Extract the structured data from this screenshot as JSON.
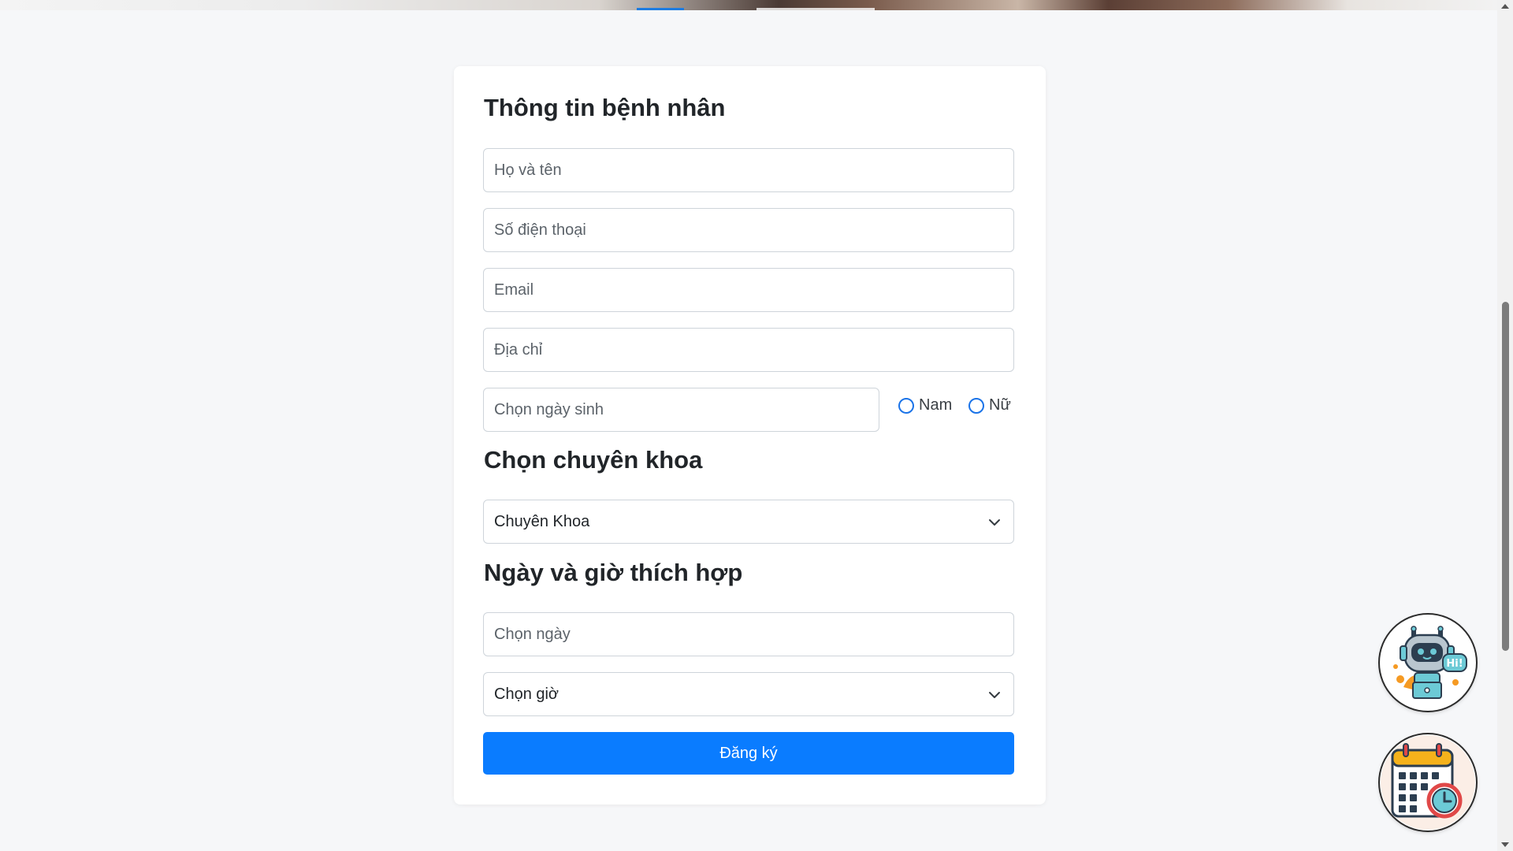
{
  "patient_section": {
    "title": "Thông tin bệnh nhân",
    "full_name_placeholder": "Họ và tên",
    "phone_placeholder": "Số điện thoại",
    "email_placeholder": "Email",
    "address_placeholder": "Địa chỉ",
    "birthdate_placeholder": "Chọn ngày sinh",
    "gender_options": [
      "Nam",
      "Nữ"
    ]
  },
  "specialty_section": {
    "title": "Chọn chuyên khoa",
    "selected": "Chuyên Khoa"
  },
  "schedule_section": {
    "title": "Ngày và giờ thích hợp",
    "date_placeholder": "Chọn ngày",
    "time_selected": "Chọn giờ"
  },
  "submit_label": "Đăng ký",
  "chatbot": {
    "badge_text": "Hi!",
    "icon": "chatbot-robot-icon"
  },
  "booking_shortcut": {
    "icon": "calendar-clock-icon"
  },
  "colors": {
    "primary": "#0a7cff",
    "radio": "#1a73e8",
    "page_bg": "#f6f7f9"
  }
}
